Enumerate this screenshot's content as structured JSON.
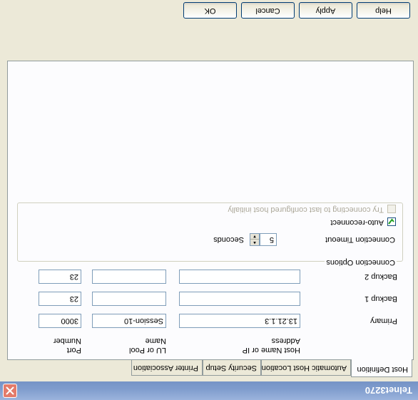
{
  "window": {
    "title": "Telnet3270"
  },
  "tabs": [
    {
      "label": "Host Definition"
    },
    {
      "label": "Automatic Host Location"
    },
    {
      "label": "Security Setup"
    },
    {
      "label": "Printer Association"
    }
  ],
  "columns": {
    "host": "Host Name or IP Address",
    "lu": "LU or Pool Name",
    "port": "Port Number"
  },
  "rows": [
    {
      "label": "Primary",
      "host": "13.21.1.3",
      "lu": "Session-10",
      "port": "3000"
    },
    {
      "label": "Backup 1",
      "host": "",
      "lu": "",
      "port": "23"
    },
    {
      "label": "Backup 2",
      "host": "",
      "lu": "",
      "port": "23"
    }
  ],
  "connection_options": {
    "title": "Connection Options",
    "timeout_label": "Connection Timeout",
    "timeout_value": "5",
    "timeout_unit": "Seconds",
    "auto_reconnect_label": "Auto-reconnect",
    "auto_reconnect_checked": true,
    "try_last_label": "Try connecting to last configured host initially",
    "try_last_enabled": false
  },
  "buttons": {
    "ok": "OK",
    "cancel": "Cancel",
    "apply": "Apply",
    "help": "Help"
  },
  "colors": {
    "titlebar": "#7f9ccd",
    "close": "#e37b6a",
    "panel": "#fcfcfe",
    "dialog": "#ece9d8"
  }
}
